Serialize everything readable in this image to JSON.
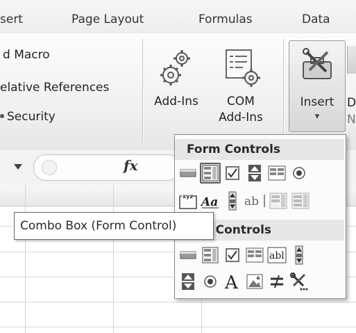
{
  "tabs": [
    {
      "label": "sert"
    },
    {
      "label": "Page Layout"
    },
    {
      "label": "Formulas"
    },
    {
      "label": "Data"
    }
  ],
  "code_group": {
    "record_macro": "d Macro",
    "relative_refs": "elative References",
    "macro_security": "Security"
  },
  "addins_group": {
    "addins_label": "Add-Ins",
    "com_addins_line1": "COM",
    "com_addins_line2": "Add-Ins"
  },
  "controls_group": {
    "insert_label": "Insert",
    "insert_arrow": "▾",
    "design_fragment_1": "D",
    "design_fragment_2": "N"
  },
  "formula_bar": {
    "fx_label": "fx"
  },
  "dropdown": {
    "form_controls_header": "Form Controls",
    "activex_header_visible": "veX Controls"
  },
  "tooltip": {
    "text": "Combo Box (Form Control)"
  },
  "colors": {
    "ribbon_bg": "#efefef",
    "highlight": "#d7d7d7",
    "header_bg": "#e6e6e6"
  }
}
